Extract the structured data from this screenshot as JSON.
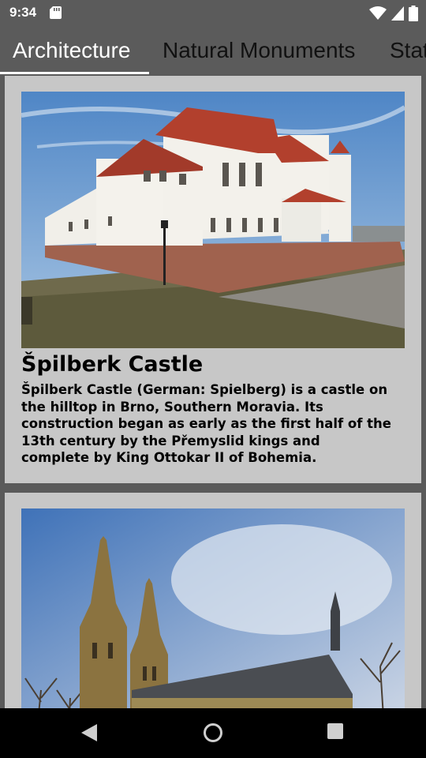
{
  "status_bar": {
    "time": "9:34",
    "icons": [
      "sd-card-icon",
      "wifi-icon",
      "signal-icon",
      "battery-icon"
    ]
  },
  "tabs": [
    {
      "label": "Architecture",
      "active": true
    },
    {
      "label": "Natural Monuments",
      "active": false
    },
    {
      "label": "Stat",
      "active": false
    }
  ],
  "cards": [
    {
      "title": "Špilberk Castle",
      "description": "Špilberk Castle (German: Spielberg) is a castle on the hilltop in Brno, Southern Moravia. Its construction began as early as the first half of the 13th century by the Přemyslid kings and complete by King Ottokar II of Bohemia.",
      "image": "castle-photo"
    },
    {
      "image": "cathedral-photo"
    }
  ],
  "nav_bar": {
    "buttons": [
      "back-icon",
      "home-icon",
      "recents-icon"
    ]
  },
  "colors": {
    "app_bar": "#5b5b5b",
    "card_background": "#c7c7c7",
    "indicator": "#ffffff"
  }
}
